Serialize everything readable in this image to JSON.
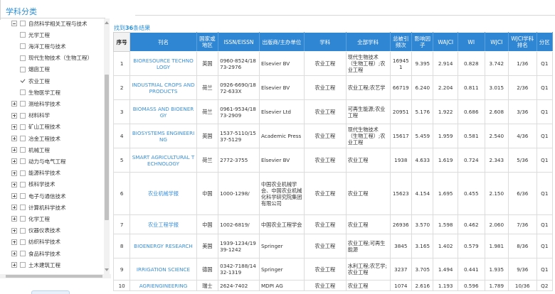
{
  "left_panel": {
    "title": "学科分类",
    "tree": [
      {
        "label": "自然科学相关工程与技术",
        "expander": "minus",
        "indent": 0,
        "check": "box"
      },
      {
        "label": "光学工程",
        "expander": "",
        "indent": 1,
        "check": "box"
      },
      {
        "label": "海洋工程与技术",
        "expander": "",
        "indent": 1,
        "check": "box"
      },
      {
        "label": "现代生物技术（生物工程）",
        "expander": "",
        "indent": 1,
        "check": "box"
      },
      {
        "label": "烟囱工程",
        "expander": "",
        "indent": 1,
        "check": "box"
      },
      {
        "label": "农业工程",
        "expander": "",
        "indent": 1,
        "check": "checked"
      },
      {
        "label": "生物医学工程",
        "expander": "",
        "indent": 1,
        "check": "box"
      },
      {
        "label": "测绘科学技术",
        "expander": "plus",
        "indent": 0,
        "check": "box"
      },
      {
        "label": "材料科学",
        "expander": "plus",
        "indent": 0,
        "check": "box"
      },
      {
        "label": "矿山工程技术",
        "expander": "plus",
        "indent": 0,
        "check": "box"
      },
      {
        "label": "冶金工程技术",
        "expander": "plus",
        "indent": 0,
        "check": "box"
      },
      {
        "label": "机械工程",
        "expander": "plus",
        "indent": 0,
        "check": "box"
      },
      {
        "label": "动力与电气工程",
        "expander": "plus",
        "indent": 0,
        "check": "box"
      },
      {
        "label": "能源科学技术",
        "expander": "plus",
        "indent": 0,
        "check": "box"
      },
      {
        "label": "核科学技术",
        "expander": "plus",
        "indent": 0,
        "check": "box"
      },
      {
        "label": "电子与通信技术",
        "expander": "plus",
        "indent": 0,
        "check": "box"
      },
      {
        "label": "计算机科学技术",
        "expander": "plus",
        "indent": 0,
        "check": "box"
      },
      {
        "label": "化学工程",
        "expander": "plus",
        "indent": 0,
        "check": "box"
      },
      {
        "label": "仪器仪表技术",
        "expander": "plus",
        "indent": 0,
        "check": "box"
      },
      {
        "label": "纺织科学技术",
        "expander": "plus",
        "indent": 0,
        "check": "box"
      },
      {
        "label": "食品科学技术",
        "expander": "plus",
        "indent": 0,
        "check": "box"
      },
      {
        "label": "土木建筑工程",
        "expander": "plus",
        "indent": 0,
        "check": "box"
      }
    ]
  },
  "results": {
    "prefix": "找到",
    "count": "36",
    "suffix": "条结果"
  },
  "table": {
    "headers": [
      "序号",
      "刊名",
      "国家或地区",
      "ISSN/EISSN",
      "出版商/主办单位",
      "学科",
      "全部学科",
      "总被引频次",
      "影响因子",
      "WAJCI",
      "WI",
      "WJCI",
      "WJCI学科排名",
      "分区"
    ],
    "rows": [
      [
        "1",
        "BIORESOURCE TECHNOLOGY",
        "英国",
        "0960-8524/1873-2976",
        "Elsevier BV",
        "农业工程",
        "现代生物技术（生物工程）;农业工程",
        "169451",
        "9.395",
        "2.914",
        "0.828",
        "3.742",
        "1/36",
        "Q1"
      ],
      [
        "2",
        "INDUSTRIAL CROPS AND PRODUCTS",
        "荷兰",
        "0926-6690/1872-633X",
        "Elsevier BV",
        "农业工程",
        "农业工程;农艺学",
        "66719",
        "6.240",
        "2.204",
        "0.811",
        "3.015",
        "2/36",
        "Q1"
      ],
      [
        "3",
        "BIOMASS AND BIOENERGY",
        "荷兰",
        "0961-9534/1873-2909",
        "Elsevier Ltd",
        "农业工程",
        "可再生能源;农业工程",
        "20951",
        "5.176",
        "1.922",
        "0.686",
        "2.608",
        "3/36",
        "Q1"
      ],
      [
        "4",
        "BIOSYSTEMS ENGINEERING",
        "英国",
        "1537-5110/1537-5129",
        "Academic Press",
        "农业工程",
        "现代生物技术（生物工程）;农业工程",
        "15617",
        "5.459",
        "1.959",
        "0.581",
        "2.540",
        "4/36",
        "Q1"
      ],
      [
        "5",
        "SMART AGRICULTURAL TECHNOLOGY",
        "荷兰",
        "2772-3755",
        "Elsevier BV",
        "农业工程",
        "农业工程",
        "1938",
        "4.633",
        "1.619",
        "0.724",
        "2.343",
        "5/36",
        "Q1"
      ],
      [
        "6",
        "农业机械学报",
        "中国",
        "1000-1298/",
        "中国农业机械学会、中国农业机械化科学研究院集团有限公司",
        "农业工程",
        "农业工程",
        "15623",
        "4.154",
        "1.695",
        "0.455",
        "2.150",
        "6/36",
        "Q1"
      ],
      [
        "7",
        "农业工程学报",
        "中国",
        "1002-6819/",
        "中国农业工程学会",
        "农业工程",
        "农业工程",
        "26936",
        "3.570",
        "1.598",
        "0.462",
        "2.060",
        "7/36",
        "Q1"
      ],
      [
        "8",
        "BIOENERGY RESEARCH",
        "美国",
        "1939-1234/1939-1242",
        "Springer",
        "农业工程",
        "农业工程;可再生能源",
        "3845",
        "3.165",
        "1.402",
        "0.579",
        "1.981",
        "8/36",
        "Q1"
      ],
      [
        "9",
        "IRRIGATION SCIENCE",
        "德国",
        "0342-7188/1432-1319",
        "Springer",
        "农业工程",
        "水利工程;农艺学;农业工程",
        "3237",
        "3.705",
        "1.494",
        "0.441",
        "1.935",
        "9/36",
        "Q1"
      ],
      [
        "10",
        "AGRIENGINEERING",
        "瑞士",
        "2624-7402",
        "MDPI AG",
        "农业工程",
        "农业工程",
        "1074",
        "2.616",
        "1.193",
        "0.596",
        "1.789",
        "10/36",
        "Q2"
      ]
    ]
  }
}
